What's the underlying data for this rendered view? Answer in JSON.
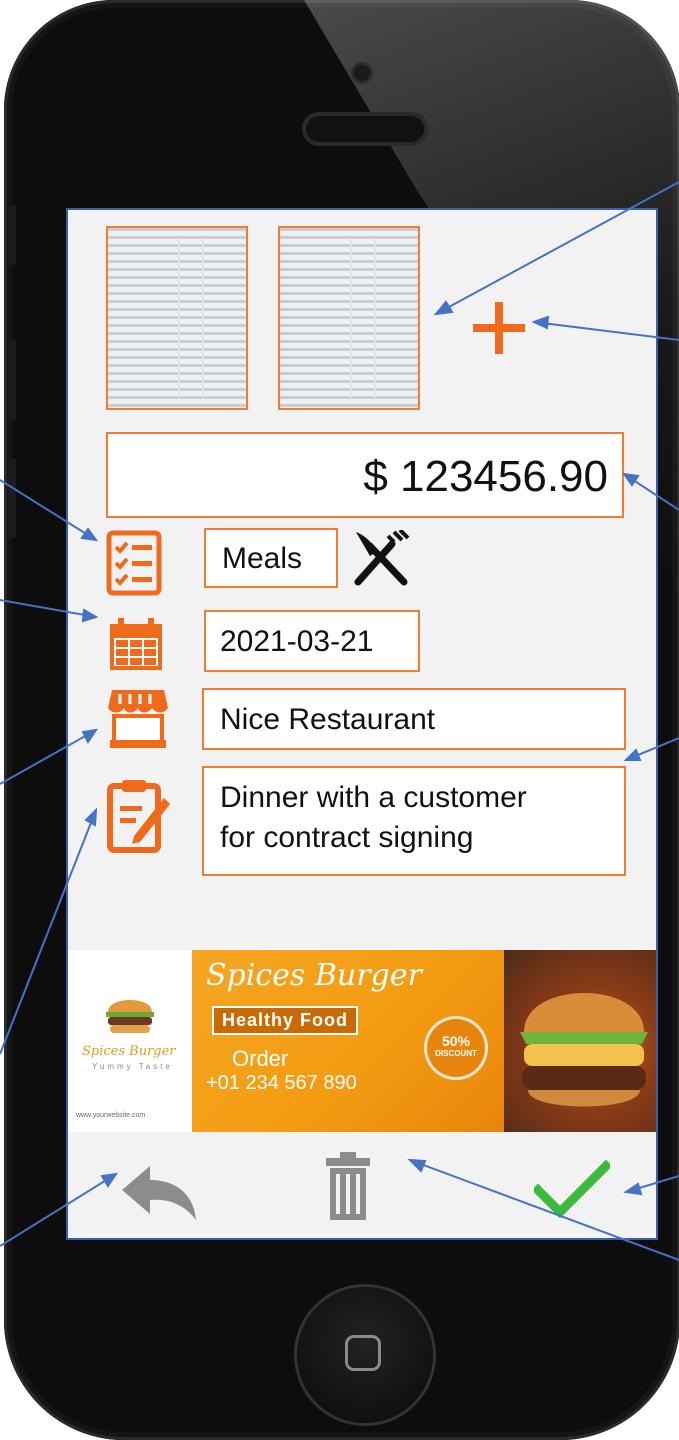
{
  "colors": {
    "accent": "#ed7d31",
    "icon_orange": "#f06a1c",
    "confirm_green": "#3cb83c",
    "muted_gray": "#8c8c8c",
    "annotation_blue": "#4472c4"
  },
  "attachments": [
    {
      "icon": "receipt-thumbnail-1"
    },
    {
      "icon": "receipt-thumbnail-2"
    }
  ],
  "add_attachment": {
    "icon": "plus-icon"
  },
  "expense": {
    "amount": "$ 123456.90",
    "category": "Meals",
    "category_icon": "fork-knife-icon",
    "date": "2021-03-21",
    "merchant": "Nice Restaurant",
    "note_line1": "Dinner with a customer",
    "note_line2": "for contract signing"
  },
  "field_icons": [
    "checklist-icon",
    "calendar-icon",
    "store-icon",
    "note-edit-icon"
  ],
  "ad_banner": {
    "title": "Spices Burger",
    "chip": "Healthy Food",
    "order_label": "Order",
    "phone": "+01 234 567 890",
    "discount_pct": "50%",
    "discount_label": "DISCOUNT",
    "logo_name": "Spices Burger",
    "logo_tag": "Yummy Taste",
    "website": "www.yourwebsite.com"
  },
  "actions": {
    "back_icon": "reply-arrow-icon",
    "delete_icon": "trash-icon",
    "confirm_icon": "checkmark-icon"
  }
}
